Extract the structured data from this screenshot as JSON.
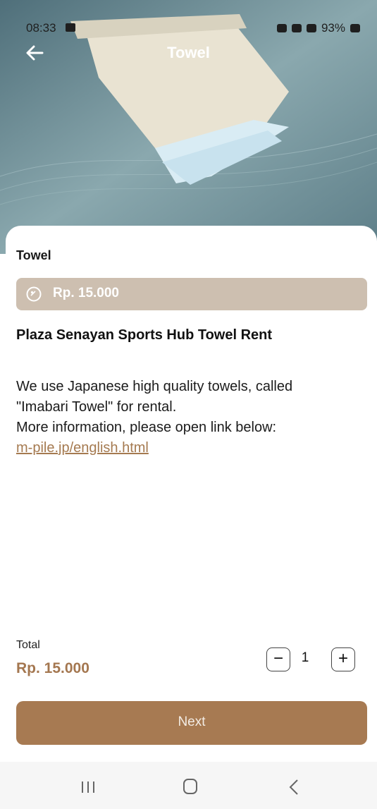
{
  "status_bar": {
    "time": "08:33",
    "battery": "93%"
  },
  "app_bar": {
    "title": "Towel"
  },
  "product": {
    "name": "Towel",
    "price": "Rp. 15.000",
    "subtitle": "Plaza Senayan Sports Hub Towel Rent",
    "description_lines": [
      "We use Japanese high quality towels, called",
      "\"Imabari Towel\" for rental.",
      "More information, please open link below:"
    ],
    "link": "m-pile.jp/english.html"
  },
  "order": {
    "total_label": "Total",
    "total_price": "Rp. 15.000",
    "quantity": "1",
    "minus_label": "−",
    "plus_label": "+"
  },
  "actions": {
    "next_label": "Next"
  },
  "colors": {
    "accent": "#a77a52",
    "price_bar": "#cdbfb0",
    "link": "#a57a50"
  }
}
